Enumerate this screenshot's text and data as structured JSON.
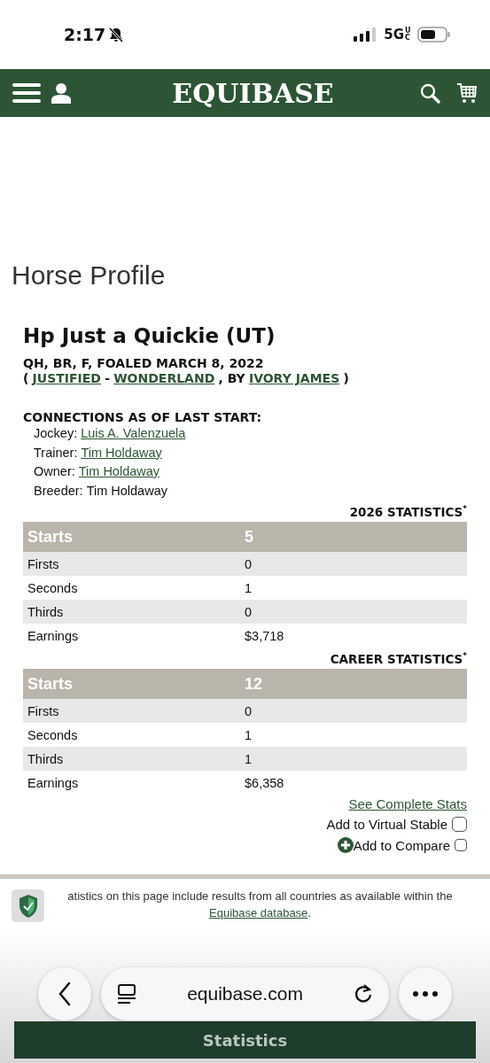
{
  "status_bar": {
    "time": "2:17",
    "network": "5G",
    "network_sub": "UC"
  },
  "header": {
    "logo": "EQUIBASE"
  },
  "page_title": "Horse Profile",
  "horse": {
    "name": "Hp Just a Quickie (UT)",
    "summary": "QH, BR, F, FOALED MARCH 8, 2022",
    "pedigree": [
      {
        "kind": "text",
        "text": "("
      },
      {
        "kind": "link",
        "text": "JUSTIFIED"
      },
      {
        "kind": "text",
        "text": "-"
      },
      {
        "kind": "link",
        "text": "WONDERLAND"
      },
      {
        "kind": "text",
        "text": ", BY"
      },
      {
        "kind": "link",
        "text": "IVORY JAMES"
      },
      {
        "kind": "text",
        "text": ")"
      }
    ]
  },
  "connections": {
    "title": "CONNECTIONS AS OF LAST START:",
    "items": [
      {
        "label": "Jockey:",
        "value": "Luis A. Valenzuela",
        "link": true
      },
      {
        "label": "Trainer:",
        "value": "Tim Holdaway",
        "link": true
      },
      {
        "label": "Owner:",
        "value": "Tim Holdaway",
        "link": true
      },
      {
        "label": "Breeder:",
        "value": "Tim Holdaway",
        "link": false
      }
    ]
  },
  "stat_tables": [
    {
      "title": "2026 STATISTICS$^{*}$",
      "header": [
        "Starts",
        "5"
      ],
      "rows": [
        [
          "Firsts",
          "0"
        ],
        [
          "Seconds",
          "1"
        ],
        [
          "Thirds",
          "0"
        ],
        [
          "Earnings",
          "$3,718"
        ]
      ]
    },
    {
      "title": "CAREER STATISTICS$^{*}$",
      "header": [
        "Starts",
        "12"
      ],
      "rows": [
        [
          "Firsts",
          "0"
        ],
        [
          "Seconds",
          "1"
        ],
        [
          "Thirds",
          "1"
        ],
        [
          "Earnings",
          "$6,358"
        ]
      ]
    }
  ],
  "actions": {
    "complete_stats": "See Complete Stats",
    "virtual_stable": {
      "label": "Add to Virtual Stable",
      "checked": false
    },
    "compare": {
      "label": "Add to Compare",
      "checked": false
    }
  },
  "footnote": {
    "text": "atistics on this page include results from all countries as available within the ",
    "link": "Equibase database",
    "end": "."
  },
  "browser": {
    "url": "equibase.com"
  },
  "bottom_button": "Statistics"
}
